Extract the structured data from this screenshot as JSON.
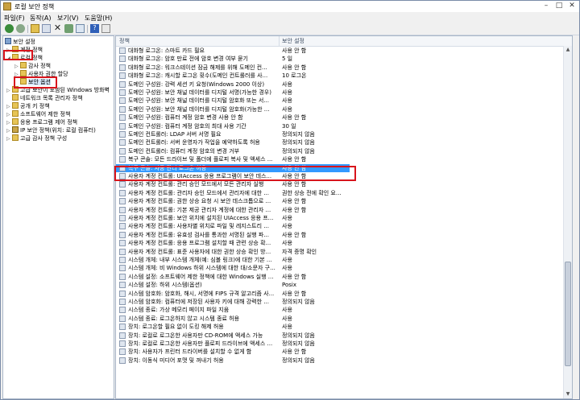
{
  "window": {
    "title": "로컬 보안 정책"
  },
  "menu": [
    "파일(F)",
    "동작(A)",
    "보기(V)",
    "도움말(H)"
  ],
  "tree": [
    {
      "label": "보안 설정",
      "arrow": "",
      "icon": "pc"
    },
    {
      "label": "계정 정책",
      "arrow": "▷",
      "icon": "fold"
    },
    {
      "label": "로컬 정책",
      "arrow": "◢",
      "icon": "fold"
    },
    {
      "label": "감사 정책",
      "arrow": "▷",
      "icon": "fold"
    },
    {
      "label": "사용자 권한 할당",
      "arrow": "▷",
      "icon": "fold"
    },
    {
      "label": "보안 옵션",
      "arrow": "",
      "icon": "fold"
    },
    {
      "label": "고급 보안이 포함된 Windows 방화벽",
      "arrow": "▷",
      "icon": "fold"
    },
    {
      "label": "네트워크 목록 관리자 정책",
      "arrow": "",
      "icon": "fold"
    },
    {
      "label": "공개 키 정책",
      "arrow": "▷",
      "icon": "fold"
    },
    {
      "label": "소프트웨어 제한 정책",
      "arrow": "▷",
      "icon": "fold"
    },
    {
      "label": "응용 프로그램 제어 정책",
      "arrow": "▷",
      "icon": "fold"
    },
    {
      "label": "IP 보안 정책(위치: 로컬 컴퓨터)",
      "arrow": "▷",
      "icon": "sec"
    },
    {
      "label": "고급 감사 정책 구성",
      "arrow": "▷",
      "icon": "fold"
    }
  ],
  "columns": {
    "policy": "정책",
    "setting": "보안 설정"
  },
  "rows": [
    {
      "policy": "대화형 로그온: 스마트 카드 필요",
      "setting": "사용 안 함"
    },
    {
      "policy": "대화형 로그온: 암호 만료 전에 암호 변경 여부 묻기",
      "setting": "5 일"
    },
    {
      "policy": "대화형 로그온: 워크스테이션 잠금 해제를 위해 도메인 컨...",
      "setting": "사용 안 함"
    },
    {
      "policy": "대화형 로그온: 캐시할 로그온 횟수(도메인 컨트롤러를 사...",
      "setting": "10 로그온"
    },
    {
      "policy": "도메인 구성원: 강력 세션 키 요청(Windows 2000 이상)",
      "setting": "사용"
    },
    {
      "policy": "도메인 구성원: 보안 채널 데이터를 디지털 서명(가능한 경우)",
      "setting": "사용"
    },
    {
      "policy": "도메인 구성원: 보안 채널 데이터를 디지털 암호화 또는 서...",
      "setting": "사용"
    },
    {
      "policy": "도메인 구성원: 보안 채널 데이터를 디지털 암호화(가능한 ...",
      "setting": "사용"
    },
    {
      "policy": "도메인 구성원: 컴퓨터 계정 암호 변경 사용 안 함",
      "setting": "사용 안 함"
    },
    {
      "policy": "도메인 구성원: 컴퓨터 계정 암호의 최대 사용 기간",
      "setting": "30 일"
    },
    {
      "policy": "도메인 컨트롤러: LDAP 서버 서명 필요",
      "setting": "정의되지 않음"
    },
    {
      "policy": "도메인 컨트롤러: 서버 운영자가 작업을 예약하도록 허용",
      "setting": "정의되지 않음"
    },
    {
      "policy": "도메인 컨트롤러: 컴퓨터 계정 암호의 변경 거부",
      "setting": "정의되지 않음"
    },
    {
      "policy": "복구 콘솔: 모든 드라이브 및 폴더에 플로피 복사 및 액세스 ...",
      "setting": "사용 안 함"
    },
    {
      "policy": "복구 콘솔: 자동 관리 로그온 허용",
      "setting": "사용 안 함"
    },
    {
      "policy": "사용자 계정 컨트롤: UIAccess 응용 프로그램이 보안 데스...",
      "setting": "사용 안 함"
    },
    {
      "policy": "사용자 계정 컨트롤: 관리 승인 모드에서 모든 관리자 실행",
      "setting": "사용 안 함"
    },
    {
      "policy": "사용자 계정 컨트롤: 관리자 승인 모드에서 관리자에 대한 ...",
      "setting": "권한 상승 전에 확인 요..."
    },
    {
      "policy": "사용자 계정 컨트롤: 권한 상승 요청 시 보안 데스크톱으로 ...",
      "setting": "사용 안 함"
    },
    {
      "policy": "사용자 계정 컨트롤: 기본 제공 관리자 계정에 대한 관리자 ...",
      "setting": "사용 안 함"
    },
    {
      "policy": "사용자 계정 컨트롤: 보안 위치에 설치된 UIAccess 응용 프...",
      "setting": "사용"
    },
    {
      "policy": "사용자 계정 컨트롤: 사용자별 위치로 파일 및 레지스트리 ...",
      "setting": "사용"
    },
    {
      "policy": "사용자 계정 컨트롤: 유효성 검사를 통과한 서명된 실행 파...",
      "setting": "사용 안 함"
    },
    {
      "policy": "사용자 계정 컨트롤: 응용 프로그램 설치할 때 관련 상승 확...",
      "setting": "사용"
    },
    {
      "policy": "사용자 계정 컨트롤: 표준 사용자에 대한 권한 상승 확인 방...",
      "setting": "자격 증명 확인"
    },
    {
      "policy": "시스템 개체: 내부 시스템 개체(예: 심볼 링크)에 대한 기본 ...",
      "setting": "사용"
    },
    {
      "policy": "시스템 개체: 비 Windows 하위 시스템에 대한 대/소문자 구...",
      "setting": "사용"
    },
    {
      "policy": "시스템 설정: 소프트웨어 제한 정책에 대한 Windows 실행 ...",
      "setting": "사용 안 함"
    },
    {
      "policy": "시스템 설정: 하위 시스템(옵션)",
      "setting": "Posix"
    },
    {
      "policy": "시스템 암호화: 암호화, 해시, 서명에 FIPS 규격 알고리즘 사...",
      "setting": "사용 안 함"
    },
    {
      "policy": "시스템 암호화: 컴퓨터에 저장된 사용자 키에 대해 강력한 ...",
      "setting": "정의되지 않음"
    },
    {
      "policy": "시스템 종료: 가상 메모리 페이지 파일 지움",
      "setting": "사용"
    },
    {
      "policy": "시스템 종료: 로그온하지 않고 시스템 종료 허용",
      "setting": "사용"
    },
    {
      "policy": "장치: 로그온할 필요 없이 도킹 해제 허용",
      "setting": "사용"
    },
    {
      "policy": "장치: 로컬로 로그온한 사용자만 CD-ROM에 액세스 가능",
      "setting": "정의되지 않음"
    },
    {
      "policy": "장치: 로컬로 로그온한 사용자만 플로피 드라이브에 액세스 ...",
      "setting": "정의되지 않음"
    },
    {
      "policy": "장치: 사용자가 프린터 드라이버를 설치할 수 없게 함",
      "setting": "사용 안 함"
    },
    {
      "policy": "장치: 이동식 미디어 포맷 및 꺼내기 허용",
      "setting": "정의되지 않음"
    }
  ]
}
